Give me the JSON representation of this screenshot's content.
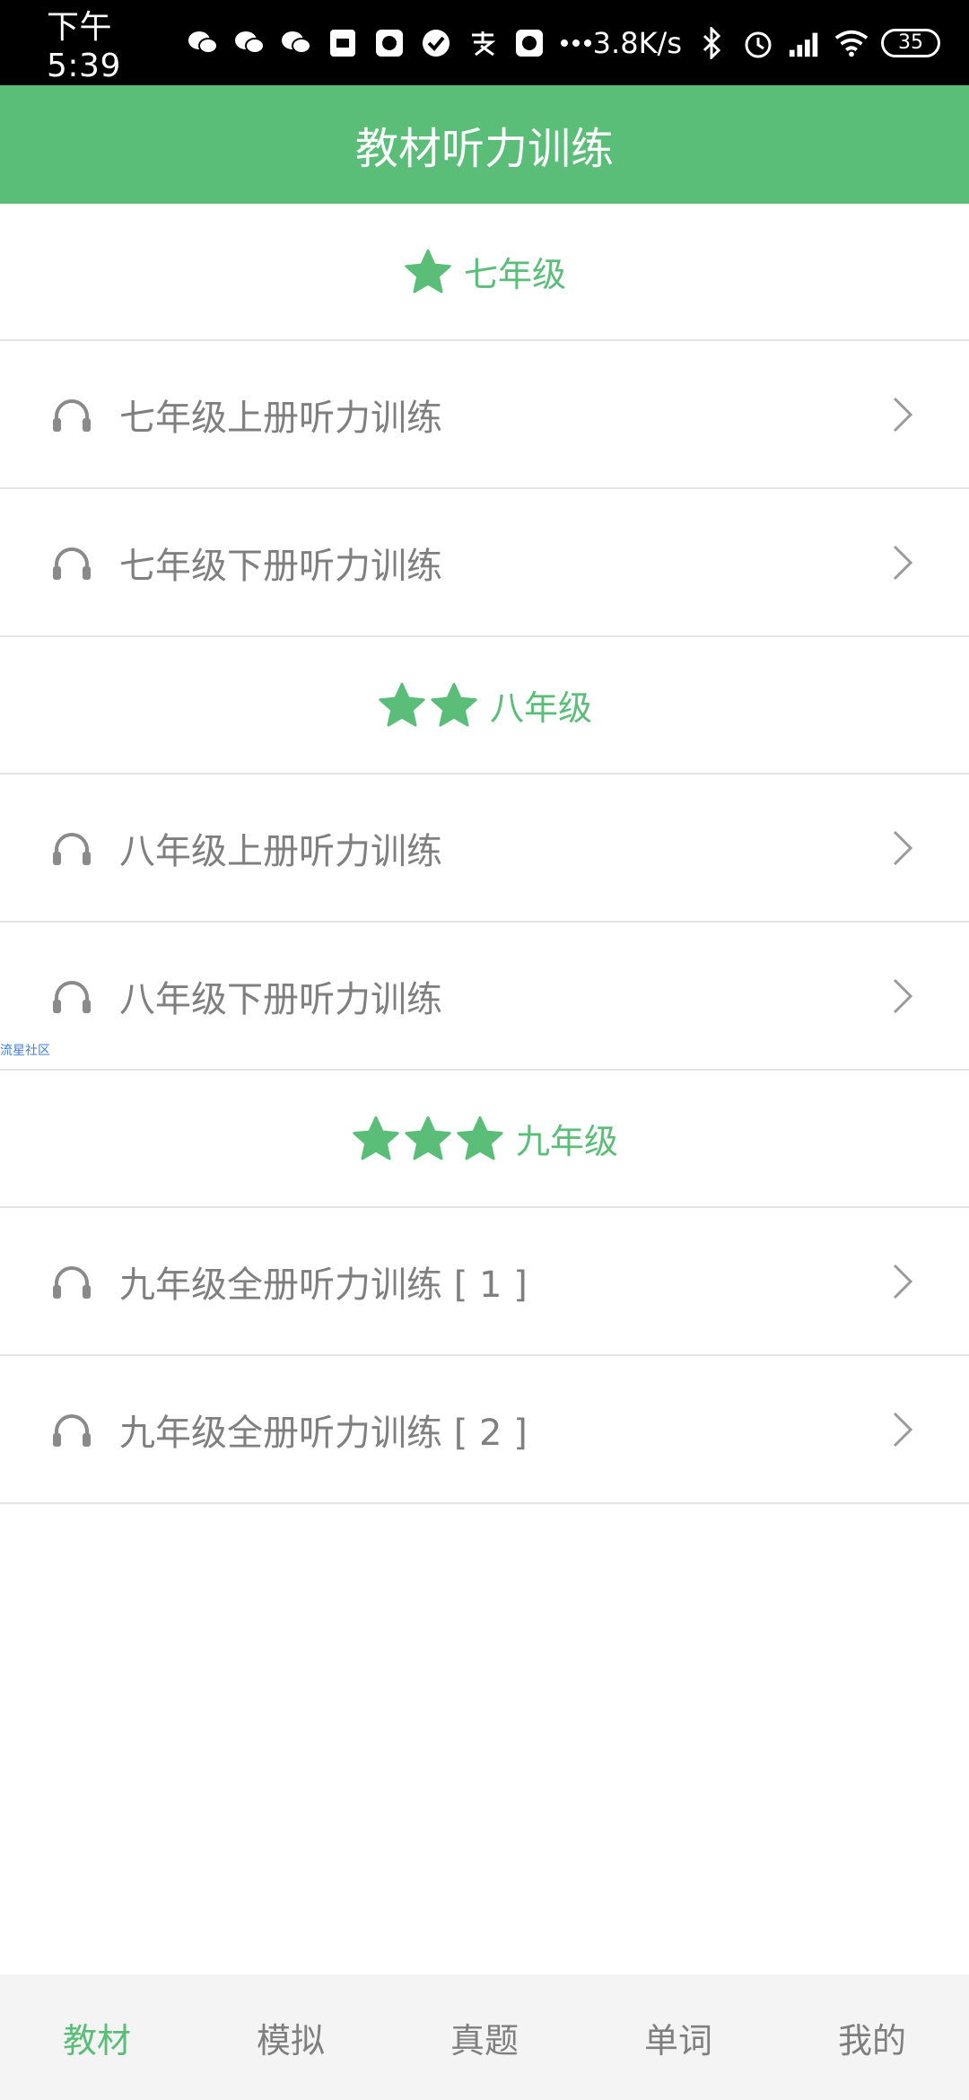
{
  "status_bar": {
    "time": "下午5:39",
    "speed": "3.8K/s",
    "battery": "35",
    "icons": [
      "wechat-icon",
      "wechat-icon",
      "wechat-icon",
      "mi-icon",
      "app-icon",
      "check-icon",
      "alipay-icon",
      "app-icon",
      "more-icon",
      "bluetooth-icon",
      "alarm-icon",
      "signal-icon",
      "wifi-icon",
      "battery-icon"
    ]
  },
  "header": {
    "title": "教材听力训练"
  },
  "sections": [
    {
      "title": "七年级",
      "stars": 1,
      "items": [
        "七年级上册听力训练",
        "七年级下册听力训练"
      ]
    },
    {
      "title": "八年级",
      "stars": 2,
      "items": [
        "八年级上册听力训练",
        "八年级下册听力训练"
      ]
    },
    {
      "title": "九年级",
      "stars": 3,
      "items": [
        "九年级全册听力训练 [ 1 ]",
        "九年级全册听力训练 [ 2 ]"
      ]
    }
  ],
  "watermark": "流星社区",
  "bottom_nav": {
    "tabs": [
      "教材",
      "模拟",
      "真题",
      "单词",
      "我的"
    ],
    "active_index": 0
  },
  "colors": {
    "accent": "#5bbe78",
    "text": "#7f7f7f",
    "divider": "#e3e3e3",
    "nav_bg": "#f4f4f4"
  }
}
